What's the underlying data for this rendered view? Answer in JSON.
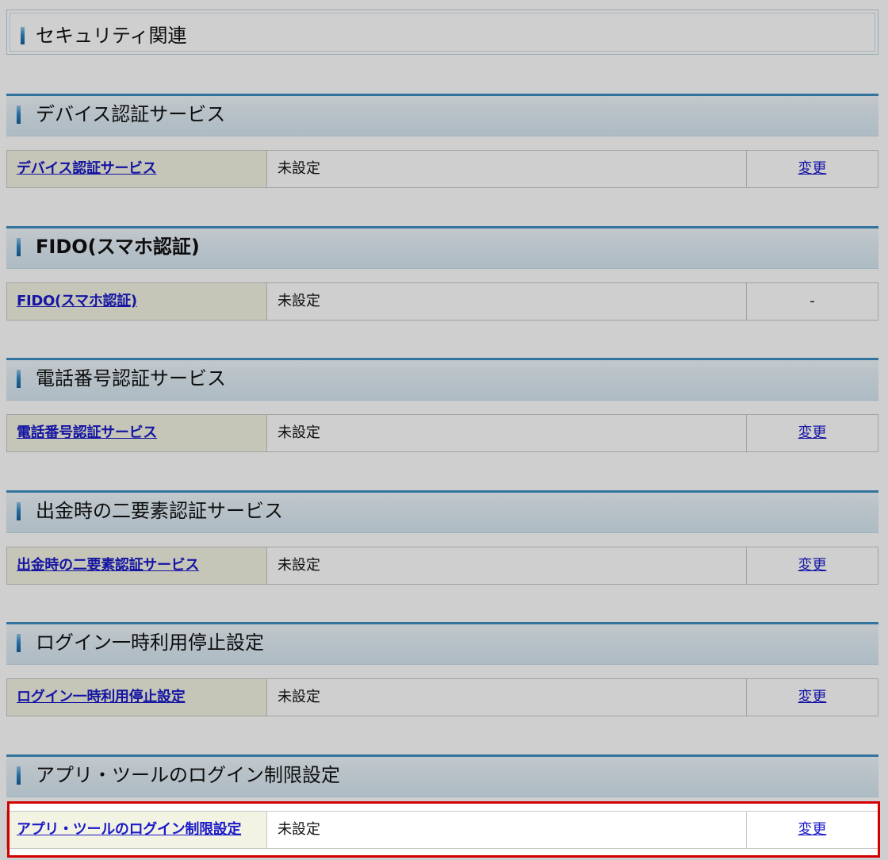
{
  "page": {
    "title": "セキュリティ関連"
  },
  "sections": [
    {
      "heading": "デバイス認証サービス",
      "label": "デバイス認証サービス",
      "value": "未設定",
      "action": "変更",
      "action_is_link": true
    },
    {
      "heading": "FIDO(スマホ認証)",
      "label": "FIDO(スマホ認証)",
      "value": "未設定",
      "action": "-",
      "action_is_link": false
    },
    {
      "heading": "電話番号認証サービス",
      "label": "電話番号認証サービス",
      "value": "未設定",
      "action": "変更",
      "action_is_link": true
    },
    {
      "heading": "出金時の二要素認証サービス",
      "label": "出金時の二要素認証サービス",
      "value": "未設定",
      "action": "変更",
      "action_is_link": true
    },
    {
      "heading": "ログイン一時利用停止設定",
      "label": "ログイン一時利用停止設定",
      "value": "未設定",
      "action": "変更",
      "action_is_link": true
    },
    {
      "heading": "アプリ・ツールのログイン制限設定",
      "label": "アプリ・ツールのログイン制限設定",
      "value": "未設定",
      "action": "変更",
      "action_is_link": true,
      "highlighted": true
    }
  ],
  "colors": {
    "link": "#1a1ac9",
    "section_accent": "#3f8fc4",
    "highlight_frame": "#d40000",
    "label_cell": "#f3f3e3"
  }
}
